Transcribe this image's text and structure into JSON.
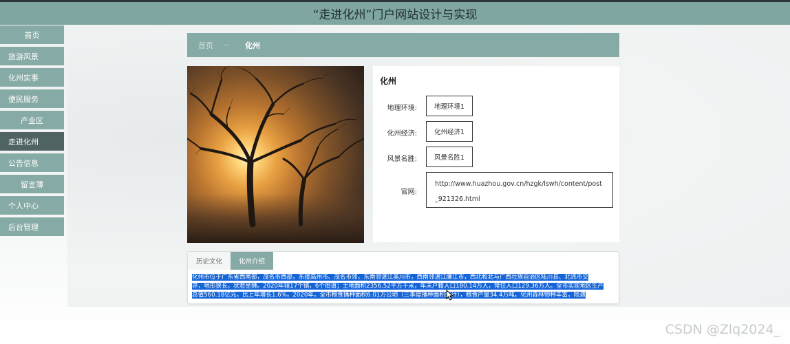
{
  "header": {
    "title": "“走进化州”门户网站设计与实现"
  },
  "sidebar": {
    "items": [
      {
        "label": "首页"
      },
      {
        "label": "旅游风景"
      },
      {
        "label": "化州实事"
      },
      {
        "label": "便民服务"
      },
      {
        "label": "产业区"
      },
      {
        "label": "走进化州"
      },
      {
        "label": "公告信息"
      },
      {
        "label": "留言薄"
      },
      {
        "label": "个人中心"
      },
      {
        "label": "后台管理"
      }
    ],
    "active_index": 5
  },
  "breadcrumb": {
    "home": "首页",
    "separator": "—",
    "current": "化州"
  },
  "detail": {
    "title": "化州",
    "fields": [
      {
        "label": "地理环境:",
        "value": "地理环境1"
      },
      {
        "label": "化州经济:",
        "value": "化州经济1"
      },
      {
        "label": "风景名胜:",
        "value": "风景名胜1"
      },
      {
        "label": "官网:",
        "value": "http://www.huazhou.gov.cn/hzgk/lswh/content/post_921326.html"
      }
    ]
  },
  "tabs": {
    "items": [
      {
        "label": "历史文化"
      },
      {
        "label": "化州介绍"
      }
    ],
    "active_index": 1,
    "content": {
      "line1": "化州市位于广东省西南部，茂名市西部，东接高州市、茂名市郊，东南邻湛江吴川市，西南邻湛江廉江市，西北和北与广西壮族自治区陆川县、北流市交",
      "line2": "界，地形狭长，状若坐狮。2020年辖17个镇，6个街道；土地面积2356.52平方千米，年末户籍人口180.14万人，常住人口129.36万人。全市实现地区生产",
      "line3": "总值560.18亿元，比上年增长1.6%。2020年，全市粮食播种面积6.01万公顷（三季度播种面积统计），粮食产量34.4万吨。化州森林物种丰富，险遇"
    }
  },
  "watermark": "CSDN @Zlq2024_",
  "colors": {
    "header_bg": "#7fa6a0",
    "sidebar_bg": "#86aaa5",
    "sidebar_active_bg": "#4f6462",
    "selection": "#1565d8"
  }
}
